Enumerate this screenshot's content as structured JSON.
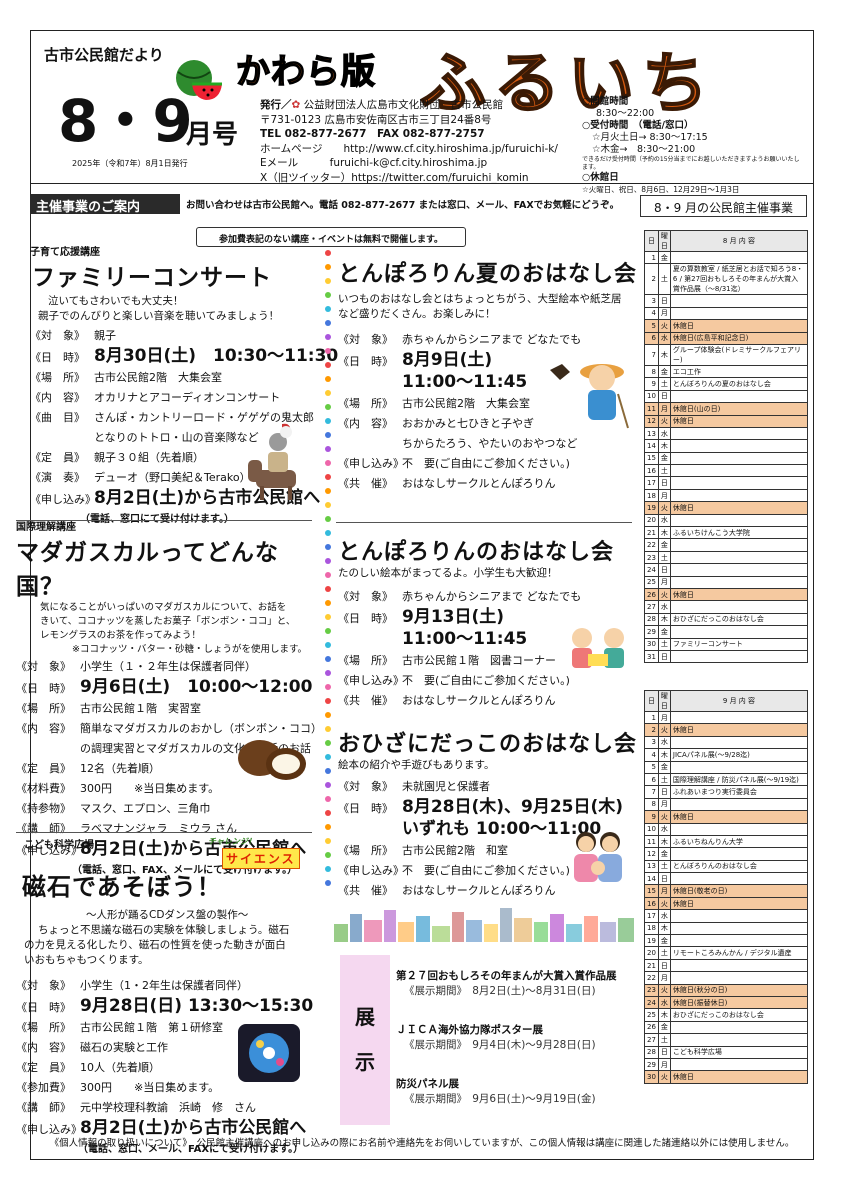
{
  "header": {
    "newsletter": "古市公民館だより",
    "month": "8・9",
    "month_suffix": "月号",
    "issued": "2025年（令和7年）8月1日発行",
    "edition": "かわら版",
    "title": "ふるいち",
    "publisher_label": "発行／",
    "publisher": "公益財団法人広島市文化財団　古市公民館",
    "address": "〒731-0123 広島市安佐南区古市三丁目24番8号",
    "tel": "TEL 082-877-2677　FAX 082-877-2757",
    "homepage": "ホームページ　　http://www.cf.city.hiroshima.jp/furuichi-k/",
    "email": "Eメール　　　furuichi-k@cf.city.hiroshima.jp",
    "x": "X（旧ツイッター）https://twitter.com/furuichi_komin",
    "hours_open_label": "○開館時間",
    "hours_open": "8:30～22:00",
    "hours_recept_label": "○受付時間　（電話/窓口）",
    "hours_recept_1": "☆月火土日→ 8:30～17:15",
    "hours_recept_2": "☆木金→　8:30～21:00",
    "hours_note": "できるだけ受付時間（予約の15分当までにお越しいただきますようお願いいたします。",
    "closed_label": "○休館日",
    "closed": "☆火曜日、祝日、8月6日、12月29日～1月3日"
  },
  "banner": {
    "label": "主催事業のご案内",
    "note": "お問い合わせは古市公民館へ。電話 082-877-2677 または窓口、メール、FAXでお気軽にどうぞ。",
    "notice": "参加費表記のない講座・イベントは無料で開催します。"
  },
  "family": {
    "cat": "子育て応援講座",
    "title": "ファミリーコンサート",
    "desc1": "泣いてもさわいでも大丈夫！",
    "desc2": "親子でのんびりと楽しい音楽を聴いてみましょう！",
    "rows": [
      [
        "《対　象》",
        "親子"
      ],
      [
        "《日　時》",
        "8月30日(土)　10:30～11:30"
      ],
      [
        "《場　所》",
        "古市公民館2階　大集会室"
      ],
      [
        "《内　容》",
        "オカリナとアコーディオンコンサート"
      ],
      [
        "《曲　目》",
        "さんぽ・カントリーロード・ゲゲゲの鬼太郎"
      ],
      [
        "",
        "となりのトトロ・山の音楽隊など"
      ],
      [
        "《定　員》",
        "親子３０組（先着順）"
      ],
      [
        "《演　奏》",
        "デューオ（野口美紀＆Terako）"
      ],
      [
        "《申し込み》",
        "8月2日(土)から古市公民館へ"
      ]
    ],
    "apply_note": "（電話、窓口にて受け付けます。）"
  },
  "madagascar": {
    "cat": "国際理解講座",
    "title": "マダガスカルってどんな国？",
    "desc1": "気になることがいっぱいのマダガスカルについて、お話を",
    "desc2": "きいて、ココナッツを蒸したお菓子「ボンボン・ココ」と、",
    "desc3": "レモングラスのお茶を作ってみよう！",
    "desc4": "※ココナッツ・バター・砂糖・しょうがを使用します。",
    "rows": [
      [
        "《対　象》",
        "小学生（１・２年生は保護者同伴）"
      ],
      [
        "《日　時》",
        "9月6日(土)　10:00～12:00"
      ],
      [
        "《場　所》",
        "古市公民館１階　実習室"
      ],
      [
        "《内　容》",
        "簡単なマダガスカルのおかし（ボンボン・ココ）"
      ],
      [
        "",
        "の調理実習とマダガスカルの文化や生活のお話"
      ],
      [
        "《定　員》",
        "12名（先着順）"
      ],
      [
        "《材料費》",
        "300円　　※当日集めます。"
      ],
      [
        "《持参物》",
        "マスク、エプロン、三角巾"
      ],
      [
        "《講　師》",
        "ラベマナンジャラ　ミウラ さん"
      ],
      [
        "《申し込み》",
        "8月2日(土)から古市公民館へ"
      ]
    ],
    "apply_note": "（電話、窓口、FAX、メールにて受け付けます。）"
  },
  "science": {
    "cat": "こども科学広場",
    "badge_top": "チャレンジ！",
    "badge": "サイエンス",
    "title": "磁石であそぼう！",
    "sub": "～人形が踊るCDダンス盤の製作～",
    "desc1": "ちょっと不思議な磁石の実験を体験しましょう。磁石",
    "desc2": "の力を見える化したり、磁石の性質を使った動きが面白",
    "desc3": "いおもちゃもつくります。",
    "rows": [
      [
        "《対　象》",
        "小学生（1・2年生は保護者同伴）"
      ],
      [
        "《日　時》",
        "9月28日(日) 13:30～15:30"
      ],
      [
        "《場　所》",
        "古市公民館１階　第１研修室"
      ],
      [
        "《内　容》",
        "磁石の実験と工作"
      ],
      [
        "《定　員》",
        "10人（先着順）"
      ],
      [
        "《参加費》",
        "300円　　※当日集めます。"
      ],
      [
        "《講　師》",
        "元中学校理科教諭　浜崎　修　さん"
      ],
      [
        "《申し込み》",
        "8月2日(土)から古市公民館へ"
      ]
    ],
    "apply_note": "（電話、窓口、メール、FAXにて受け付けます。）"
  },
  "summer_story": {
    "title": "とんぽろりん夏のおはなし会",
    "desc1": "いつものおはなし会とはちょっとちがう、大型絵本や紙芝居",
    "desc2": "など盛りだくさん。お楽しみに！",
    "rows": [
      [
        "《対　象》",
        "赤ちゃんからシニアまで どなたでも"
      ],
      [
        "《日　時》",
        "8月9日(土)"
      ],
      [
        "",
        "11:00～11:45"
      ],
      [
        "《場　所》",
        "古市公民館2階　大集会室"
      ],
      [
        "《内　容》",
        "おおかみと七ひきと子やぎ"
      ],
      [
        "",
        "ちからたろう、やたいのおやつなど"
      ],
      [
        "《申し込み》",
        "不　要(ご自由にご参加ください。)"
      ],
      [
        "《共　催》",
        "おはなしサークルとんぽろりん"
      ]
    ]
  },
  "story": {
    "title": "とんぽろりんのおはなし会",
    "desc": "たのしい絵本がまってるよ。小学生も大歓迎！",
    "rows": [
      [
        "《対　象》",
        "赤ちゃんからシニアまで どなたでも"
      ],
      [
        "《日　時》",
        "9月13日(土)"
      ],
      [
        "",
        "11:00～11:45"
      ],
      [
        "《場　所》",
        "古市公民館１階　図書コーナー"
      ],
      [
        "《申し込み》",
        "不　要(ご自由にご参加ください。)"
      ],
      [
        "《共　催》",
        "おはなしサークルとんぽろりん"
      ]
    ]
  },
  "ohiza": {
    "title": "おひざにだっこのおはなし会",
    "desc": "絵本の紹介や手遊びもあります。",
    "rows": [
      [
        "《対　象》",
        "未就園児と保護者"
      ],
      [
        "《日　時》",
        "8月28日(木)、9月25日(木)"
      ],
      [
        "",
        "いずれも 10:00～11:00"
      ],
      [
        "《場　所》",
        "古市公民館2階　和室"
      ],
      [
        "《申し込み》",
        "不　要(ご自由にご参加ください。)"
      ],
      [
        "《共　催》",
        "おはなしサークルとんぽろりん"
      ]
    ]
  },
  "exhibit": {
    "label1": "展",
    "label2": "示",
    "items": [
      {
        "title": "第２７回おもしろその年まんが大賞入賞作品展",
        "period": "《展示期間》　8月2日(土)～8月31日(日)"
      },
      {
        "title": "ＪＩＣＡ海外協力隊ポスター展",
        "period": "《展示期間》　9月4日(木)～9月28日(日)"
      },
      {
        "title": "防災パネル展",
        "period": "《展示期間》　9月6日(土)～9月19日(金)"
      }
    ]
  },
  "calendar": {
    "title": "8・9 月の公民館主催事業",
    "head_day": "日",
    "head_wd": "曜日",
    "aug_head": "8 月 内 容",
    "sep_head": "9 月 内 容",
    "aug": [
      [
        "1",
        "金",
        "",
        false
      ],
      [
        "2",
        "土",
        "夏の算数教室 / 紙芝居とお話で知ろう8・6 / 第27回おもしろその年まんが大賞入賞作品展（～8/31迄）",
        false
      ],
      [
        "3",
        "日",
        "",
        false
      ],
      [
        "4",
        "月",
        "",
        false
      ],
      [
        "5",
        "火",
        "休館日",
        true
      ],
      [
        "6",
        "水",
        "休館日(広島平和記念日)",
        true
      ],
      [
        "7",
        "木",
        "グループ体験会(ドレミサークルフェアリー)",
        false
      ],
      [
        "8",
        "金",
        "エコ工作",
        false
      ],
      [
        "9",
        "土",
        "とんぼろりんの夏のおはなし会",
        false
      ],
      [
        "10",
        "日",
        "",
        false
      ],
      [
        "11",
        "月",
        "休館日(山の日)",
        true
      ],
      [
        "12",
        "火",
        "休館日",
        true
      ],
      [
        "13",
        "水",
        "",
        false
      ],
      [
        "14",
        "木",
        "",
        false
      ],
      [
        "15",
        "金",
        "",
        false
      ],
      [
        "16",
        "土",
        "",
        false
      ],
      [
        "17",
        "日",
        "",
        false
      ],
      [
        "18",
        "月",
        "",
        false
      ],
      [
        "19",
        "火",
        "休館日",
        true
      ],
      [
        "20",
        "水",
        "",
        false
      ],
      [
        "21",
        "木",
        "ふるいちけんこう大学院",
        false
      ],
      [
        "22",
        "金",
        "",
        false
      ],
      [
        "23",
        "土",
        "",
        false
      ],
      [
        "24",
        "日",
        "",
        false
      ],
      [
        "25",
        "月",
        "",
        false
      ],
      [
        "26",
        "火",
        "休館日",
        true
      ],
      [
        "27",
        "水",
        "",
        false
      ],
      [
        "28",
        "木",
        "おひざにだっこのおはなし会",
        false
      ],
      [
        "29",
        "金",
        "",
        false
      ],
      [
        "30",
        "土",
        "ファミリーコンサート",
        false
      ],
      [
        "31",
        "日",
        "",
        false
      ]
    ],
    "sep": [
      [
        "1",
        "月",
        "",
        false
      ],
      [
        "2",
        "火",
        "休館日",
        true
      ],
      [
        "3",
        "水",
        "",
        false
      ],
      [
        "4",
        "木",
        "JICAパネル展(～9/28迄)",
        false
      ],
      [
        "5",
        "金",
        "",
        false
      ],
      [
        "6",
        "土",
        "国際理解講座 / 防災パネル展(～9/19迄)",
        false
      ],
      [
        "7",
        "日",
        "ふれあいまつり実行委員会",
        false
      ],
      [
        "8",
        "月",
        "",
        false
      ],
      [
        "9",
        "火",
        "休館日",
        true
      ],
      [
        "10",
        "水",
        "",
        false
      ],
      [
        "11",
        "木",
        "ふるいちねんりん大学",
        false
      ],
      [
        "12",
        "金",
        "",
        false
      ],
      [
        "13",
        "土",
        "とんぼろりんのおはなし会",
        false
      ],
      [
        "14",
        "日",
        "",
        false
      ],
      [
        "15",
        "月",
        "休館日(敬老の日)",
        true
      ],
      [
        "16",
        "火",
        "休館日",
        true
      ],
      [
        "17",
        "水",
        "",
        false
      ],
      [
        "18",
        "木",
        "",
        false
      ],
      [
        "19",
        "金",
        "",
        false
      ],
      [
        "20",
        "土",
        "リモートころみんかん / デジタル遺産",
        false
      ],
      [
        "21",
        "日",
        "",
        false
      ],
      [
        "22",
        "月",
        "",
        false
      ],
      [
        "23",
        "火",
        "休館日(秋分の日)",
        true
      ],
      [
        "24",
        "水",
        "休館日(振替休日)",
        true
      ],
      [
        "25",
        "木",
        "おひざにだっこのおはなし会",
        false
      ],
      [
        "26",
        "金",
        "",
        false
      ],
      [
        "27",
        "土",
        "",
        false
      ],
      [
        "28",
        "日",
        "こども科学広場",
        false
      ],
      [
        "29",
        "月",
        "",
        false
      ],
      [
        "30",
        "火",
        "休館日",
        true
      ]
    ]
  },
  "footer": "《個人情報の取り扱いについて》　公民館主催講座へのお申し込みの際にお名前や連絡先をお伺いしていますが、この個人情報は講座に関連した諸連絡以外には使用しません。",
  "colors": {
    "title_orange": "#d55a10",
    "holiday": "#f5c9a0",
    "banner": "#2a2a2a",
    "tenji": "#f5d8f0"
  }
}
